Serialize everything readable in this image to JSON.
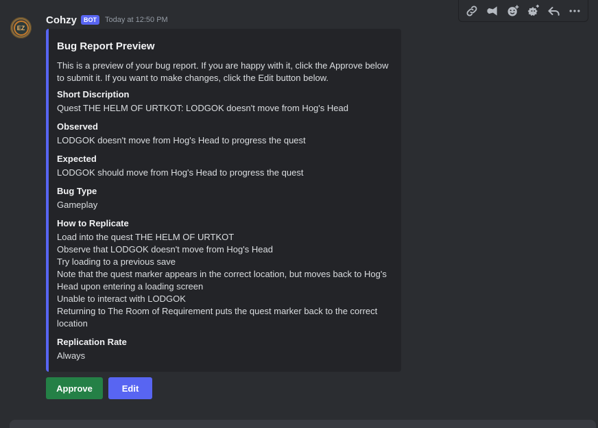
{
  "message": {
    "avatar_text": "EZ",
    "username": "Cohzy",
    "bot_tag": "BOT",
    "timestamp": "Today at 12:50 PM"
  },
  "toolbar": {
    "icons": [
      "link-icon",
      "send-icon",
      "add-reaction-icon",
      "add-super-reaction-icon",
      "reply-icon",
      "more-icon"
    ]
  },
  "embed": {
    "accent_color": "#5865f2",
    "title": "Bug Report Preview",
    "description": "This is a preview of your bug report. If you are happy with it, click the Approve below to submit it. If you want to make changes, click the Edit button below.",
    "fields": [
      {
        "name": "Short Discription",
        "value": [
          "Quest THE HELM OF URTKOT: LODGOK doesn't move from Hog's Head"
        ]
      },
      {
        "name": "Observed",
        "value": [
          "LODGOK doesn't move from Hog's Head to progress the quest"
        ]
      },
      {
        "name": "Expected",
        "value": [
          "LODGOK should move from Hog's Head to progress the quest"
        ]
      },
      {
        "name": "Bug Type",
        "value": [
          "Gameplay"
        ]
      },
      {
        "name": "How to Replicate",
        "value": [
          "Load into the quest THE HELM OF URTKOT",
          "Observe that LODGOK doesn't move from Hog's Head",
          "Try loading to a previous save",
          "Note that the quest marker appears in the correct location, but moves back to Hog's Head upon entering a loading screen",
          "Unable to interact with LODGOK",
          "Returning to The Room of Requirement puts the quest marker back to the correct location"
        ]
      },
      {
        "name": "Replication Rate",
        "value": [
          "Always"
        ]
      }
    ]
  },
  "buttons": {
    "approve_label": "Approve",
    "edit_label": "Edit",
    "approve_color": "#248046",
    "edit_color": "#5865f2"
  }
}
